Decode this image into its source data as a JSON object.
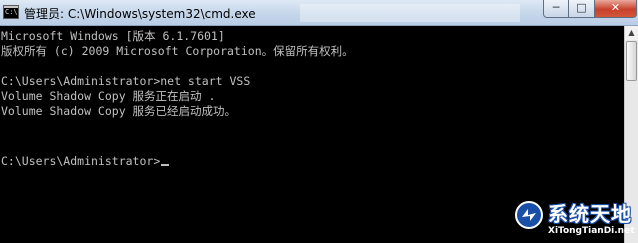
{
  "window": {
    "title": "管理员: C:\\Windows\\system32\\cmd.exe",
    "icon": "cmd-icon",
    "icon_text": "C:\\",
    "controls": {
      "minimize": "─",
      "maximize": "□",
      "close": "✕"
    }
  },
  "console": {
    "lines": [
      "Microsoft Windows [版本 6.1.7601]",
      "版权所有 (c) 2009 Microsoft Corporation。保留所有权利。",
      "",
      "C:\\Users\\Administrator>net start VSS",
      "Volume Shadow Copy 服务正在启动 .",
      "Volume Shadow Copy 服务已经启动成功。",
      "",
      "",
      "C:\\Users\\Administrator>"
    ],
    "text_color": "#c0c0c0",
    "background": "#000000"
  },
  "scrollbar": {
    "up_arrow": "▲"
  },
  "watermark": {
    "title": "系统天地",
    "url": "XiTongTianDi.net",
    "color": "#1a4fa8"
  }
}
